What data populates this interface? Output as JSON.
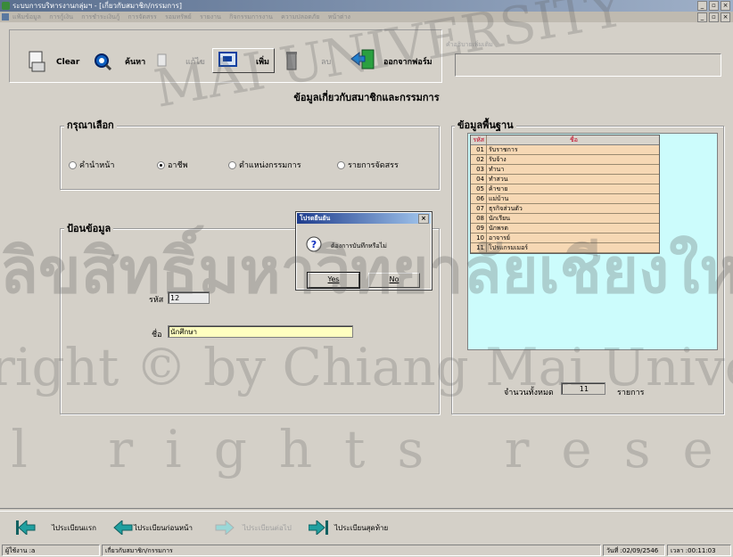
{
  "window": {
    "title": "ระบบการบริหารงานกลุ่มฯ - [เกี่ยวกับสมาชิก/กรรมการ]",
    "min_icon": "minimize-icon",
    "restore_icon": "restore-icon",
    "close_icon": "close-icon"
  },
  "menu": {
    "items": [
      "แฟ้มข้อมูล",
      "การกู้เงิน",
      "การชำระเงินกู้",
      "การจัดสรร",
      "รอมทรัพย์",
      "รายงาน",
      "กิจกรรมการงาน",
      "ความปลอดภัย",
      "หน้าต่าง"
    ]
  },
  "toolbar": {
    "clear": "Clear",
    "search": "ค้นหา",
    "edit": "แก้ไข",
    "add": "เพิ่ม",
    "delete": "ลบ",
    "exit": "ออกจากฟอร์ม",
    "info_caption": "คำอธิบายเพิ่มเติม"
  },
  "page_title": "ข้อมูลเกี่ยวกับสมาชิกและกรรมการ",
  "choose": {
    "legend": "กรุณาเลือก",
    "options": [
      "คำนำหน้า",
      "อาชีพ",
      "ตำแหน่งกรรมการ",
      "รายการจัดสรร"
    ],
    "selected": "อาชีพ"
  },
  "entry": {
    "legend": "ป้อนข้อมูล",
    "code_label": "รหัส",
    "code_value": "12",
    "name_label": "ชื่อ",
    "name_value": "นักศึกษา"
  },
  "base": {
    "legend": "ข้อมูลพื้นฐาน",
    "col_code": "รหัส",
    "col_name": "ชื่อ",
    "rows": [
      {
        "code": "01",
        "name": "รับราชการ"
      },
      {
        "code": "02",
        "name": "รับจ้าง"
      },
      {
        "code": "03",
        "name": "ทำนา"
      },
      {
        "code": "04",
        "name": "ทำสวน"
      },
      {
        "code": "05",
        "name": "ค้าขาย"
      },
      {
        "code": "06",
        "name": "แม่บ้าน"
      },
      {
        "code": "07",
        "name": "ธุรกิจส่วนตัว"
      },
      {
        "code": "08",
        "name": "นักเรียน"
      },
      {
        "code": "09",
        "name": "นักพรต"
      },
      {
        "code": "10",
        "name": "อาจารย์"
      },
      {
        "code": "11",
        "name": "โปรแกรมเมอร์"
      }
    ],
    "total_label": "จำนวนทั้งหมด",
    "total_value": "11",
    "total_unit": "รายการ"
  },
  "dialog": {
    "title": "โปรดยืนยัน",
    "message": "ต้องการบันทึกหรือไม่",
    "yes": "Yes",
    "no": "No",
    "icon": "question-icon"
  },
  "nav": {
    "first": "ไประเบียนแรก",
    "prev": "ไประเบียนก่อนหน้า",
    "next": "ไประเบียนต่อไป",
    "last": "ไประเบียนสุดท้าย"
  },
  "status": {
    "user": "ผู้ใช้งาน :a",
    "form": "เกี่ยวกับสมาชิก/กรรมการ",
    "date": "วันที่ :02/09/2546",
    "time": "เวลา :00:11:03"
  },
  "watermark": {
    "top": "MAI UNIVERSITY",
    "thai": "ลิขสิทธิ์มหาวิทยาลัยเชียงใหม่",
    "copyright": "Copyright © by Chiang Mai University",
    "rights": "All rights reserved"
  },
  "colors": {
    "title_grad_start": "#5a6f8f",
    "dialog_title": "#1e3c8c",
    "grid_row_bg": "#f6d8b4",
    "grid_panel_bg": "#ccfcfc",
    "name_input_bg": "#ffffc0",
    "nav_arrow": "#20a0a0"
  }
}
